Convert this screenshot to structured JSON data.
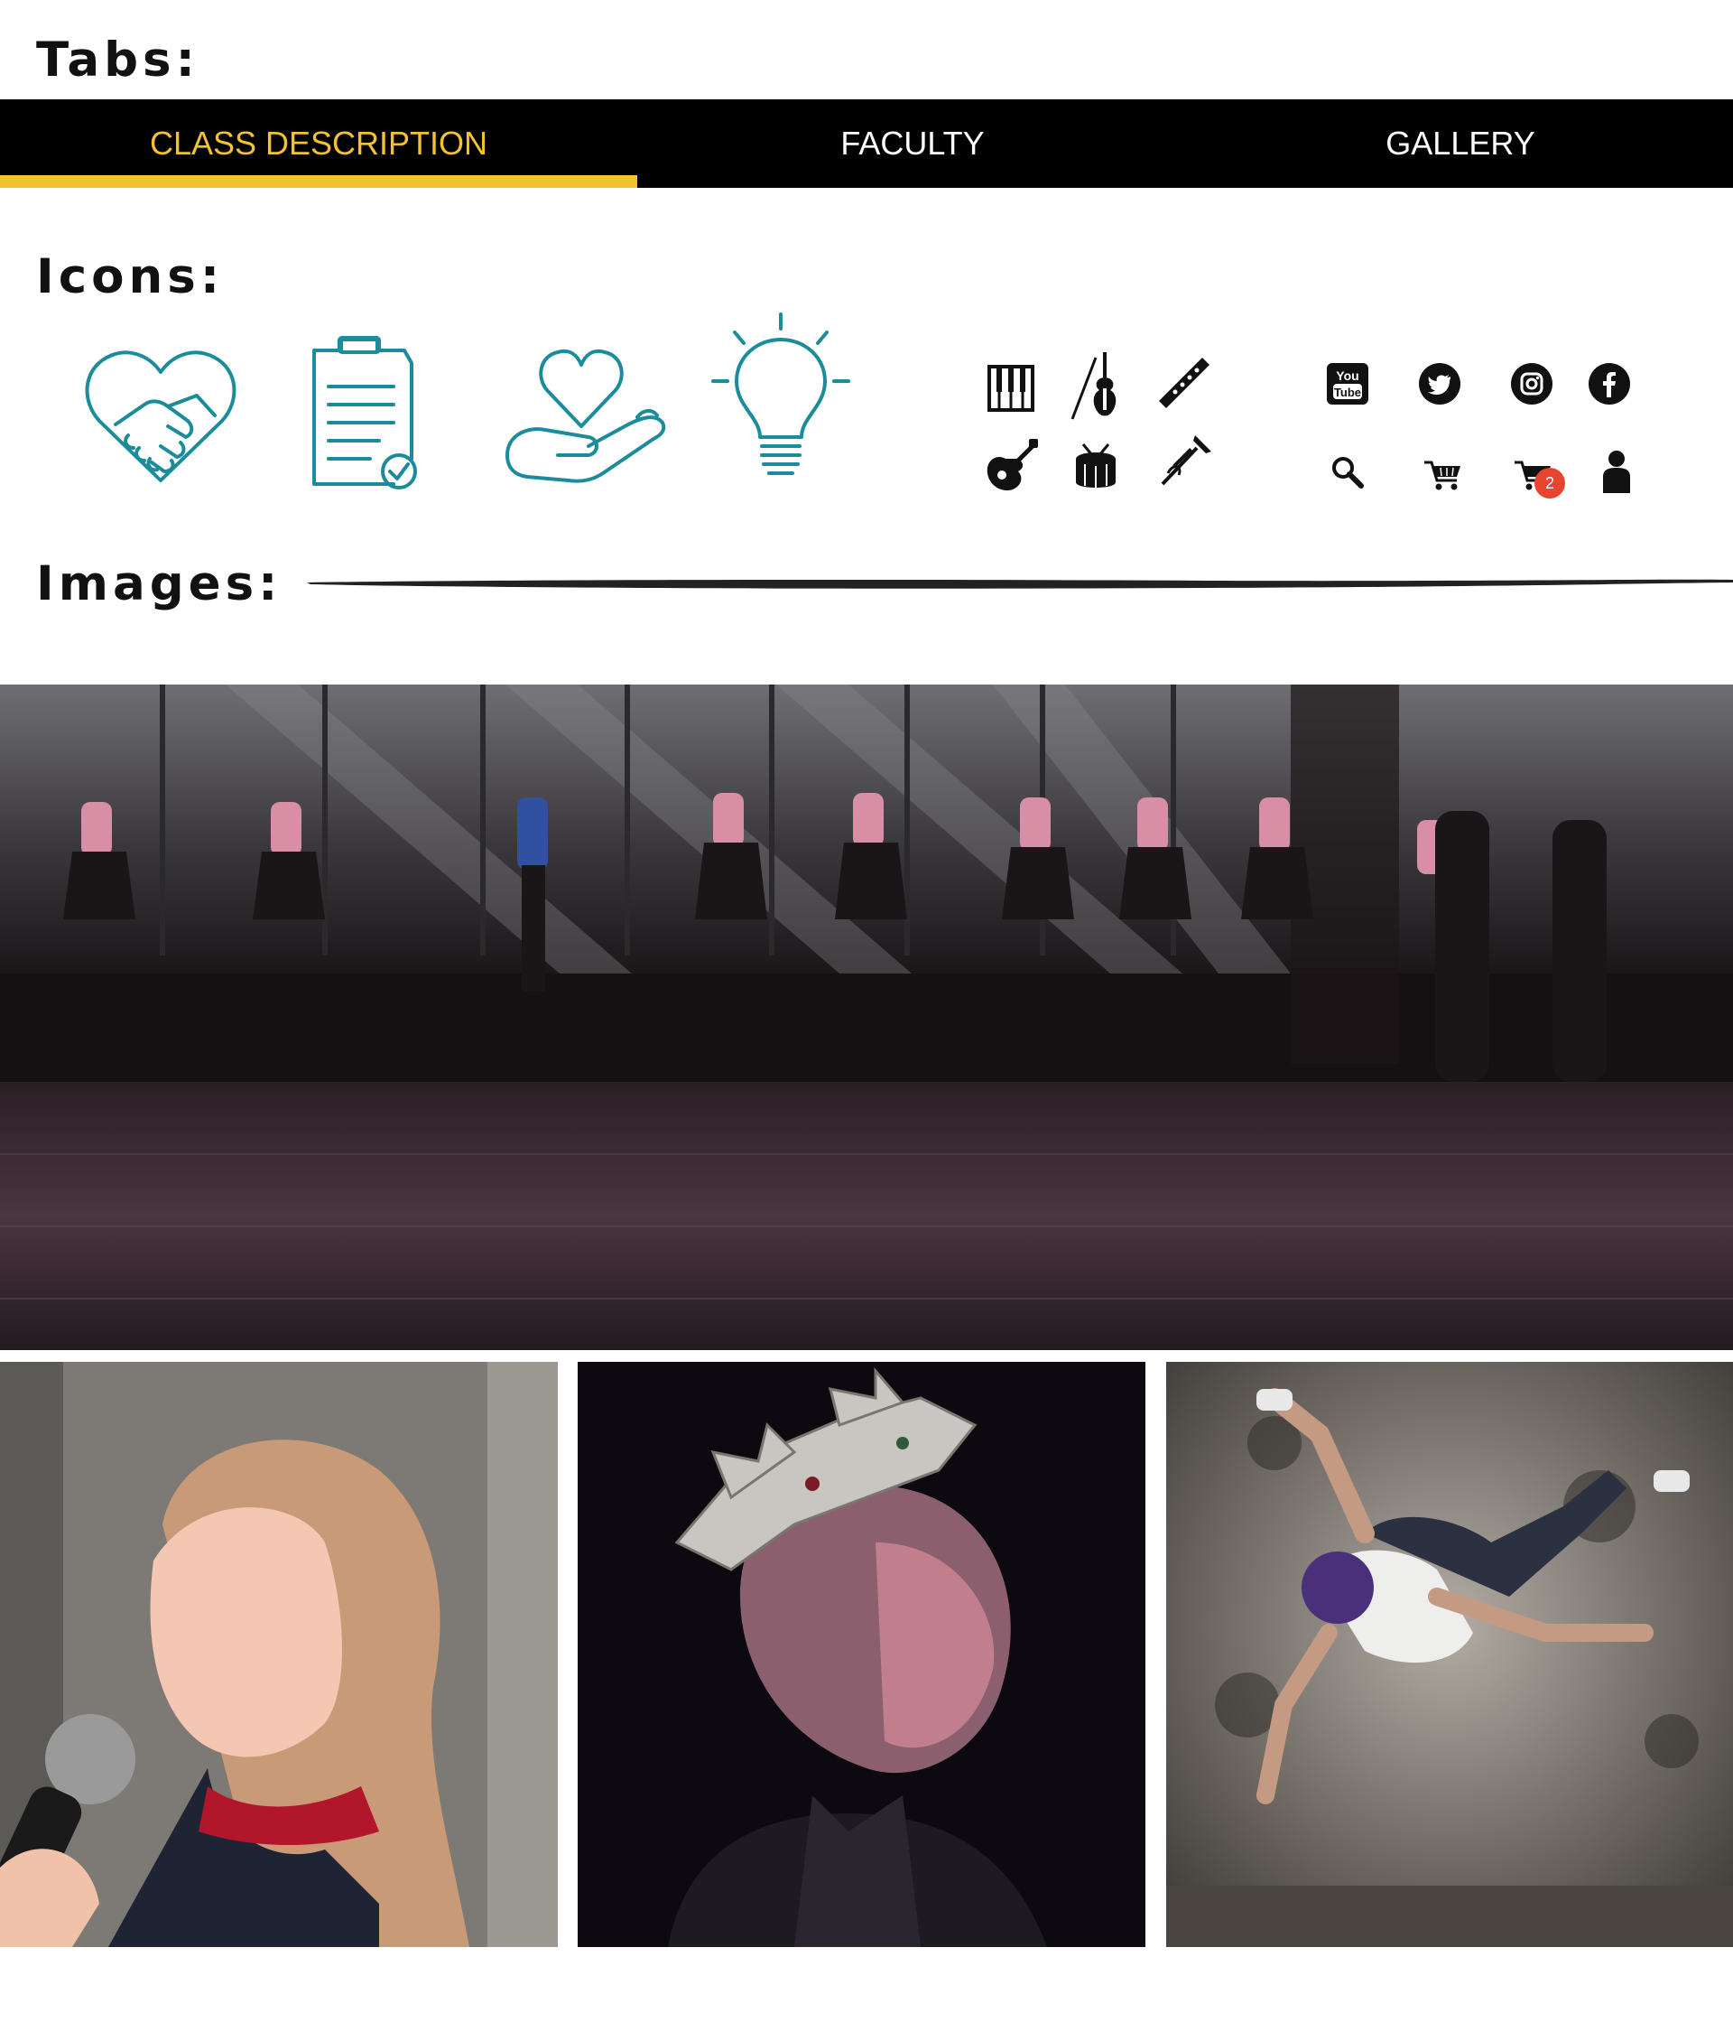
{
  "headings": {
    "tabs": "Tabs:",
    "icons": "Icons:",
    "images": "Images:"
  },
  "tabs": [
    {
      "label": "CLASS DESCRIPTION",
      "active": true
    },
    {
      "label": "FACULTY",
      "active": false
    },
    {
      "label": "GALLERY",
      "active": false
    }
  ],
  "colors": {
    "accent": "#f2c230",
    "tab_bar": "#000000",
    "icon_teal": "#1b8c9b",
    "badge": "#e8442f"
  },
  "icons": {
    "feature": [
      "heart-handshake-icon",
      "clipboard-check-icon",
      "heart-in-hand-icon",
      "lightbulb-icon"
    ],
    "instruments": [
      "piano-keys-icon",
      "violin-icon",
      "flute-icon",
      "guitar-icon",
      "drum-icon",
      "trumpet-icon"
    ],
    "social": [
      "youtube-icon",
      "twitter-icon",
      "instagram-icon",
      "facebook-icon"
    ],
    "utility": [
      "search-icon",
      "cart-icon",
      "cart-with-badge-icon",
      "user-icon"
    ]
  },
  "youtube_text": {
    "line1": "You",
    "line2": "Tube"
  },
  "cart_badge_count": "2",
  "images": [
    "ballet-class-photo",
    "girl-singing-photo",
    "actor-crown-photo",
    "breakdancer-photo"
  ]
}
